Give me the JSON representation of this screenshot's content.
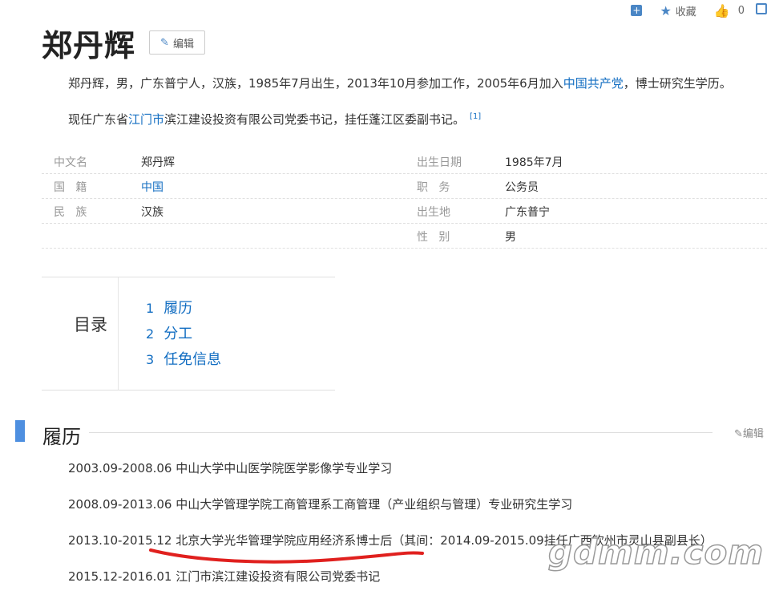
{
  "topbar": {
    "collect_label": "收藏",
    "like_count": "0"
  },
  "title": "郑丹辉",
  "edit_label": "编辑",
  "summary": {
    "line1_a": "郑丹辉，男，广东普宁人，汉族，1985年7月出生，2013年10月参加工作，2005年6月加入",
    "line1_link": "中国共产党",
    "line1_b": "，博士研究生学历。",
    "line2_a": "现任广东省",
    "line2_link": "江门市",
    "line2_b": "滨江建设投资有限公司党委书记，挂任蓬江区委副书记。",
    "ref": "[1]"
  },
  "info": {
    "rows": [
      {
        "l_label": "中文名",
        "l_value": "郑丹辉",
        "r_label": "出生日期",
        "r_value": "1985年7月"
      },
      {
        "l_label": "国   籍",
        "l_value": "中国",
        "r_label": "职   务",
        "r_value": "公务员"
      },
      {
        "l_label": "民   族",
        "l_value": "汉族",
        "r_label": "出生地",
        "r_value": "广东普宁"
      },
      {
        "l_label": "",
        "l_value": "",
        "r_label": "性   别",
        "r_value": "男"
      }
    ]
  },
  "toc": {
    "heading": "目录",
    "items": [
      {
        "num": "1",
        "label": "履历"
      },
      {
        "num": "2",
        "label": "分工"
      },
      {
        "num": "3",
        "label": "任免信息"
      }
    ]
  },
  "section": {
    "title": "履历",
    "edit_label": "编辑"
  },
  "bio": [
    "2003.09-2008.06 中山大学中山医学院医学影像学专业学习",
    "2008.09-2013.06 中山大学管理学院工商管理系工商管理（产业组织与管理）专业研究生学习",
    "2013.10-2015.12 北京大学光华管理学院应用经济系博士后（其间：2014.09-2015.09挂任广西钦州市灵山县副县长）",
    "2015.12-2016.01 江门市滨江建设投资有限公司党委书记"
  ],
  "watermark": "gdmm.com",
  "colors": {
    "link": "#136ec2",
    "accent": "#4e8fe0",
    "annotation": "#e0201e"
  }
}
